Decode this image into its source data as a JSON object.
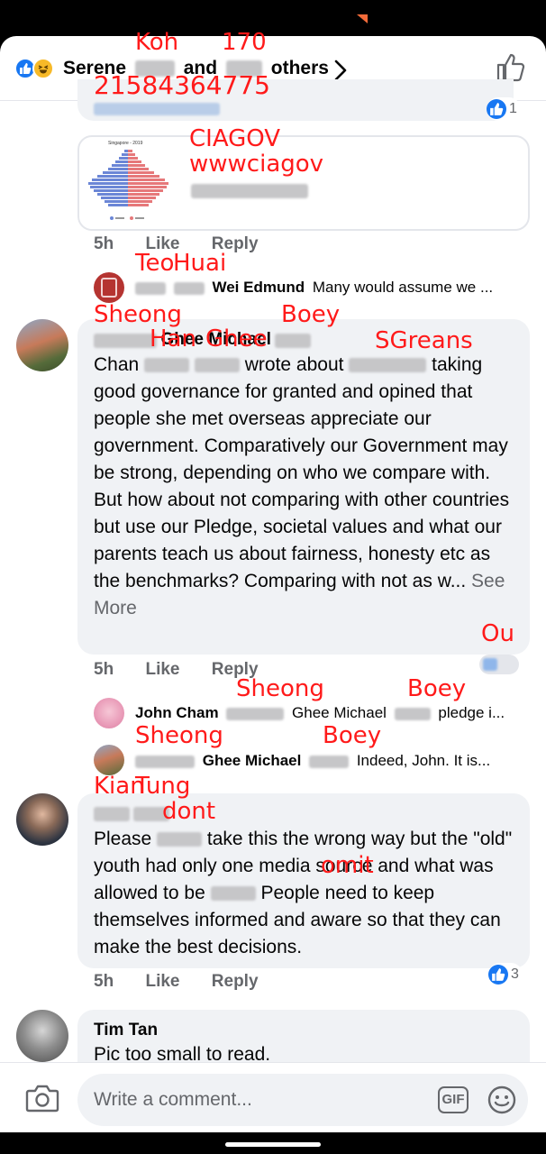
{
  "overlay": {
    "koh": "Koh",
    "n170": "170",
    "phone": "21584364775",
    "ciagov": "CIAGOV",
    "wwwciagov": "wwwciagov",
    "teo": "Teo",
    "huai": "Huai",
    "sheong1": "Sheong",
    "boey1": "Boey",
    "han": "Han",
    "ghee": "Ghee",
    "sgreans": "SGreans",
    "ou": "Ou",
    "sheong2": "Sheong",
    "boey2": "Boey",
    "sheong3": "Sheong",
    "boey3": "Boey",
    "kian": "Kian",
    "tung": "Tung",
    "dont": "dont",
    "omit": "omit"
  },
  "header": {
    "name": "Serene",
    "and_text": "and",
    "others_text": "others"
  },
  "top_comment": {
    "reaction_count": "1"
  },
  "preview": {
    "chart_title": "Singapore - 2019"
  },
  "comment1_meta": {
    "time": "5h",
    "like": "Like",
    "reply": "Reply"
  },
  "reply1": {
    "author": "Wei Edmund",
    "text": "Many would assume we ..."
  },
  "comment2": {
    "author_visible": "Ghee Michael",
    "text_before": "Chan",
    "text_mid": "wrote about",
    "text_body": "taking good governance for granted and opined that people she met overseas appreciate our government. Comparatively our Government may be strong, depending on who we compare with. But how about not comparing with other countries but use our Pledge, societal values and what our parents teach us about fairness, honesty etc as the benchmarks? Comparing with not as w...",
    "see_more": "See More",
    "time": "5h",
    "like": "Like",
    "reply": "Reply"
  },
  "reply2": {
    "author": "John Cham",
    "mention": "Ghee Michael",
    "text": "pledge i..."
  },
  "reply3": {
    "author": "Ghee Michael",
    "text": "Indeed, John. It is..."
  },
  "comment3": {
    "text_please": "Please",
    "text_body1": "take this the wrong way but the \"old\" youth had only one media source and what was allowed to be",
    "text_body2": "People need to keep themselves informed and aware so that they can make the best decisions.",
    "time": "5h",
    "like": "Like",
    "reply": "Reply",
    "reaction_count": "3"
  },
  "comment4": {
    "author": "Tim Tan",
    "text": "Pic too small to read."
  },
  "composer": {
    "placeholder": "Write a comment...",
    "gif": "GIF"
  },
  "colors": {
    "facebook_blue": "#1877f2",
    "bubble_gray": "#f0f2f5",
    "overlay_red": "#ff1a1a"
  },
  "icons": [
    "like-reaction-icon",
    "haha-reaction-icon",
    "chevron-right-icon",
    "thumbs-up-icon",
    "camera-icon",
    "gif-icon",
    "emoji-icon"
  ]
}
